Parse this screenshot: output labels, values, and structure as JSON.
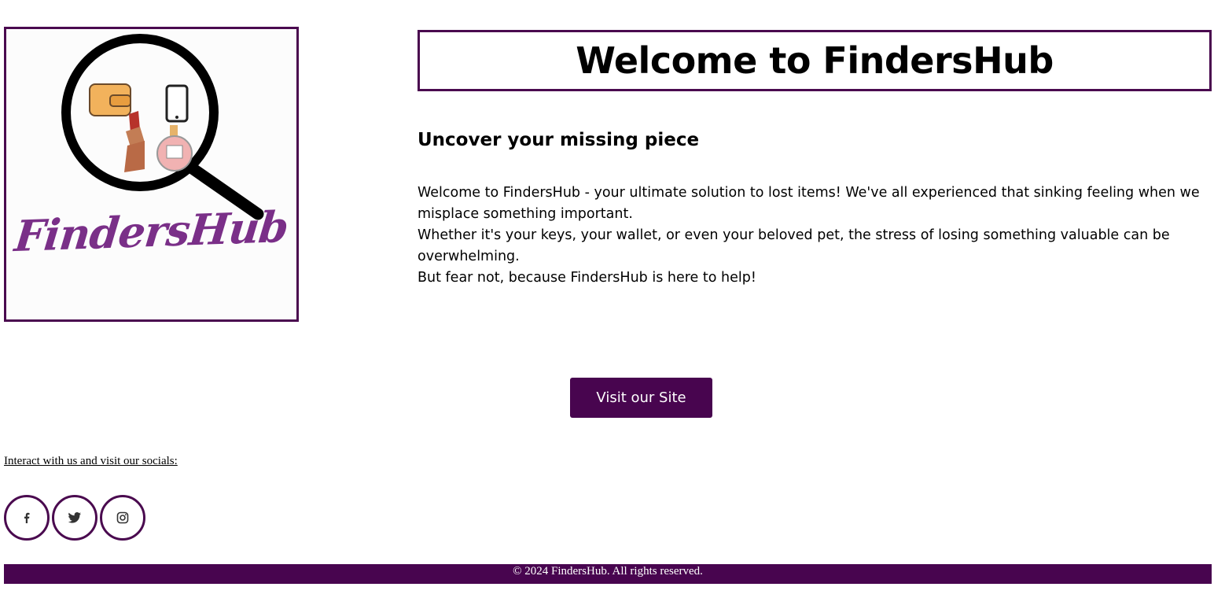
{
  "brand": {
    "logo_wordmark": "FindersHub",
    "accent_color": "#48054f"
  },
  "header": {
    "title": "Welcome to FindersHub"
  },
  "main": {
    "subtitle": "Uncover your missing piece",
    "paragraphs": [
      "Welcome to FindersHub - your ultimate solution to lost items! We've all experienced that sinking feeling when we misplace something important.",
      "Whether it's your keys, your wallet, or even your beloved pet, the stress of losing something valuable can be overwhelming.",
      "But fear not, because FindersHub is here to help!"
    ],
    "cta_label": "Visit our Site"
  },
  "socials": {
    "link_text": "Interact with us and visit our socials:",
    "icons": [
      "facebook-icon",
      "twitter-icon",
      "instagram-icon"
    ]
  },
  "footer": {
    "copyright": "© 2024 FindersHub. All rights reserved."
  }
}
